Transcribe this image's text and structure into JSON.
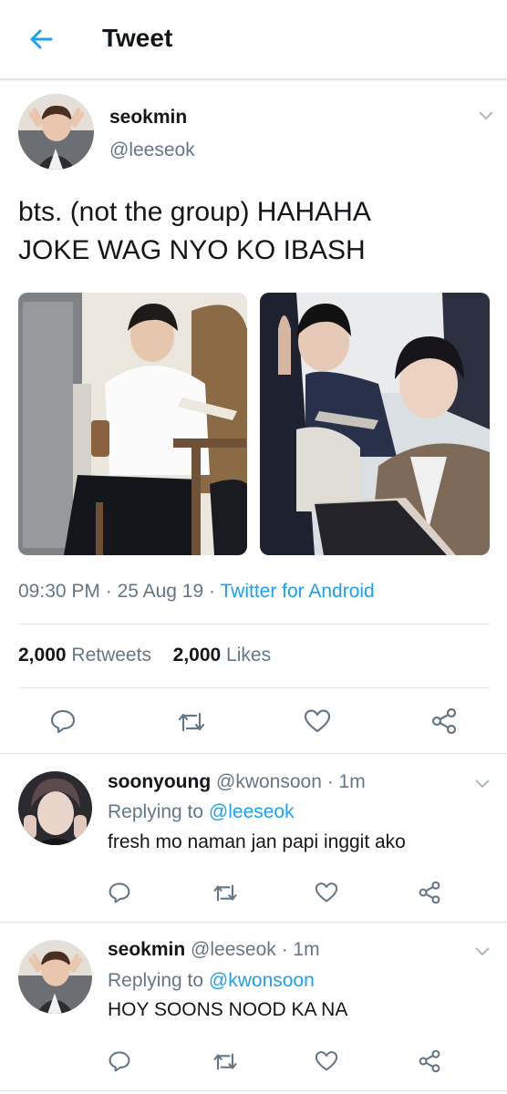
{
  "header": {
    "title": "Tweet"
  },
  "tweet": {
    "name": "seokmin",
    "handle": "@leeseok",
    "text_line1": "bts. (not the group) HAHAHA",
    "text_line2": "JOKE WAG NYO KO IBASH",
    "time": "09:30 PM",
    "date": "25 Aug 19",
    "source": "Twitter for Android",
    "sep": "·",
    "retweets_count": "2,000",
    "retweets_label": "Retweets",
    "likes_count": "2,000",
    "likes_label": "Likes"
  },
  "replies": [
    {
      "name": "soonyoung",
      "handle": "@kwonsoon",
      "time": "· 1m",
      "replying_label": "Replying to",
      "replying_to": "@leeseok",
      "text": "fresh mo naman jan papi inggit ako"
    },
    {
      "name": "seokmin",
      "handle": "@leeseok",
      "time": "· 1m",
      "replying_label": "Replying to",
      "replying_to": "@kwonsoon",
      "text": "HOY SOONS NOOD KA NA"
    }
  ],
  "icons": {
    "back": "arrow-left-icon",
    "chevron": "chevron-down-icon",
    "reply": "reply-icon",
    "retweet": "retweet-icon",
    "like": "heart-icon",
    "share": "share-icon"
  },
  "colors": {
    "accent": "#1da1f2",
    "muted": "#657786",
    "text": "#14171a",
    "divider": "#e1e8ed"
  }
}
